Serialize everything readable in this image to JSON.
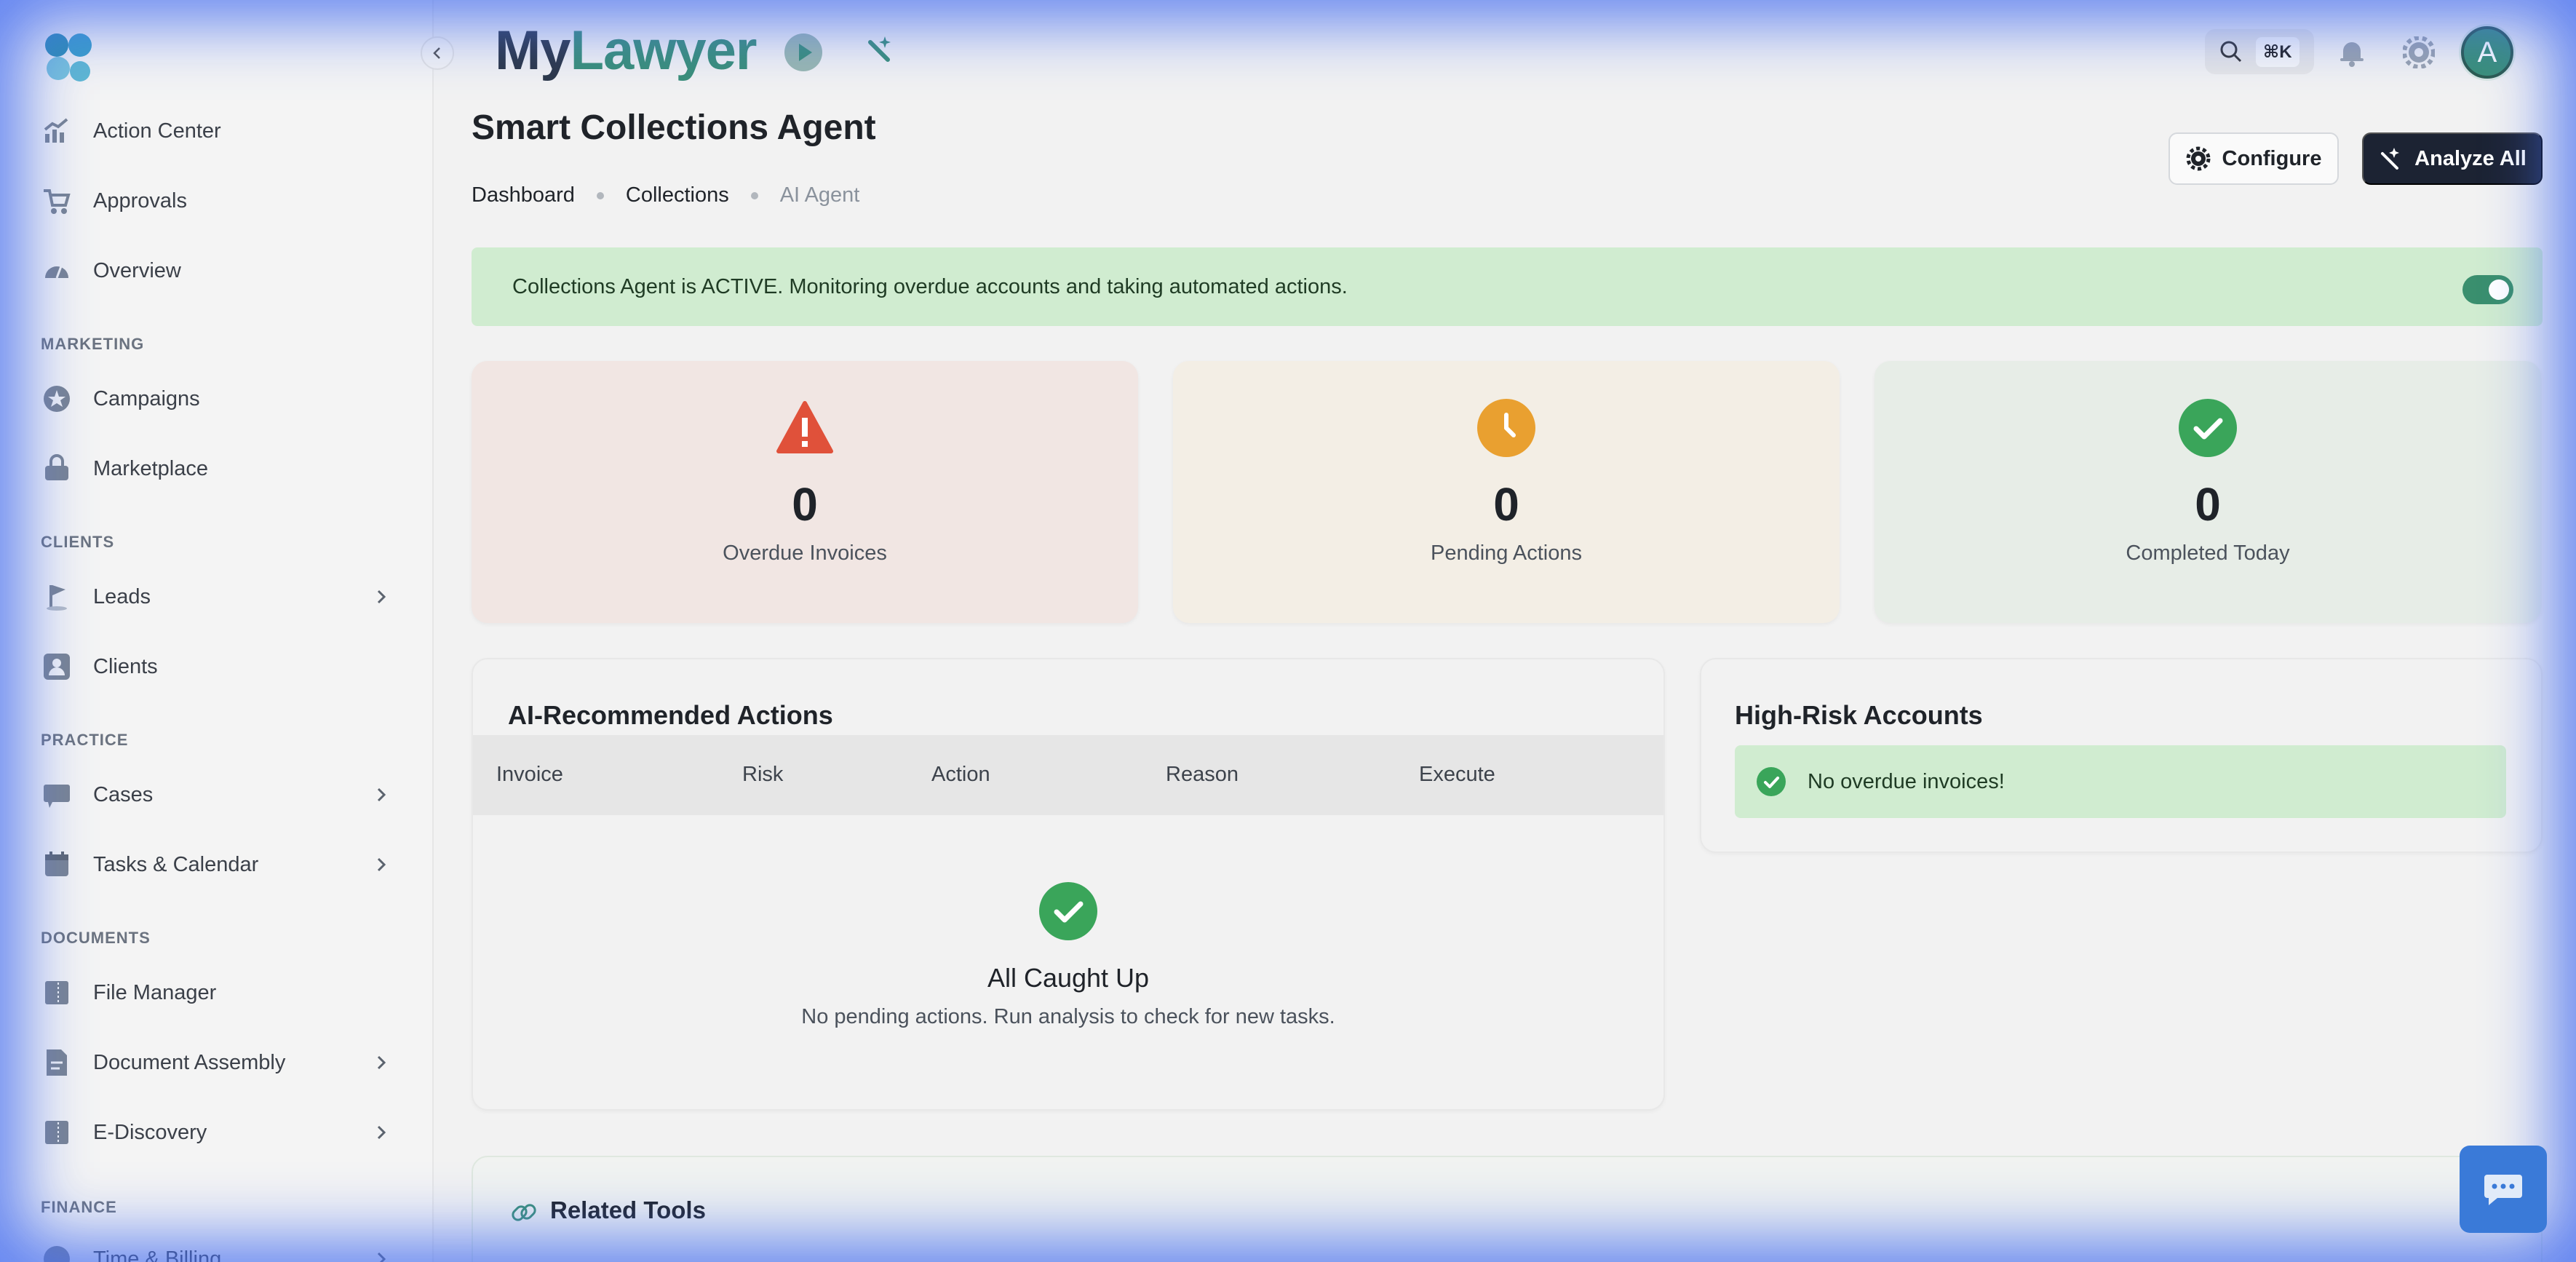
{
  "app": {
    "brand_prefix": "My",
    "brand_suffix": "Lawyer",
    "search_shortcut": "⌘K",
    "avatar_initial": "A"
  },
  "sidebar": {
    "items_top": [
      {
        "label": "Action Center",
        "icon": "chart-up-icon"
      },
      {
        "label": "Approvals",
        "icon": "cart-icon"
      },
      {
        "label": "Overview",
        "icon": "gauge-icon"
      }
    ],
    "sections": {
      "marketing": "MARKETING",
      "clients": "CLIENTS",
      "practice": "PRACTICE",
      "documents": "DOCUMENTS",
      "finance": "FINANCE"
    },
    "marketing": [
      {
        "label": "Campaigns",
        "icon": "star-badge-icon"
      },
      {
        "label": "Marketplace",
        "icon": "shopping-bag-icon"
      }
    ],
    "clients": [
      {
        "label": "Leads",
        "icon": "flag-icon"
      },
      {
        "label": "Clients",
        "icon": "user-card-icon"
      }
    ],
    "practice": [
      {
        "label": "Cases",
        "icon": "briefcase-icon"
      },
      {
        "label": "Tasks & Calendar",
        "icon": "calendar-icon"
      }
    ],
    "documents": [
      {
        "label": "File Manager",
        "icon": "folder-icon"
      },
      {
        "label": "Document Assembly",
        "icon": "document-icon"
      },
      {
        "label": "E-Discovery",
        "icon": "folder-search-icon"
      }
    ],
    "finance": [
      {
        "label": "Time & Billing",
        "icon": "clock-icon"
      }
    ]
  },
  "page": {
    "title": "Smart Collections Agent",
    "breadcrumb": [
      "Dashboard",
      "Collections",
      "AI Agent"
    ],
    "configure_label": "Configure",
    "analyze_label": "Analyze All",
    "banner_text": "Collections Agent is ACTIVE. Monitoring overdue accounts and taking automated actions.",
    "agent_active": true
  },
  "stats": [
    {
      "value": "0",
      "label": "Overdue Invoices",
      "icon": "warning-icon",
      "color": "#e0513a"
    },
    {
      "value": "0",
      "label": "Pending Actions",
      "icon": "clock-icon",
      "color": "#e9a030"
    },
    {
      "value": "0",
      "label": "Completed Today",
      "icon": "check-circle-icon",
      "color": "#3aa55a"
    }
  ],
  "recommended": {
    "title": "AI-Recommended Actions",
    "columns": [
      "Invoice",
      "Risk",
      "Action",
      "Reason",
      "Execute"
    ],
    "empty_title": "All Caught Up",
    "empty_sub": "No pending actions. Run analysis to check for new tasks."
  },
  "high_risk": {
    "title": "High-Risk Accounts",
    "empty_text": "No overdue invoices!"
  },
  "related": {
    "title": "Related Tools"
  },
  "colors": {
    "accent_green": "#3a8f78",
    "success_bg": "#d0ecd0",
    "dark_button": "#1c2333",
    "chat_button": "#3a7ad8"
  }
}
